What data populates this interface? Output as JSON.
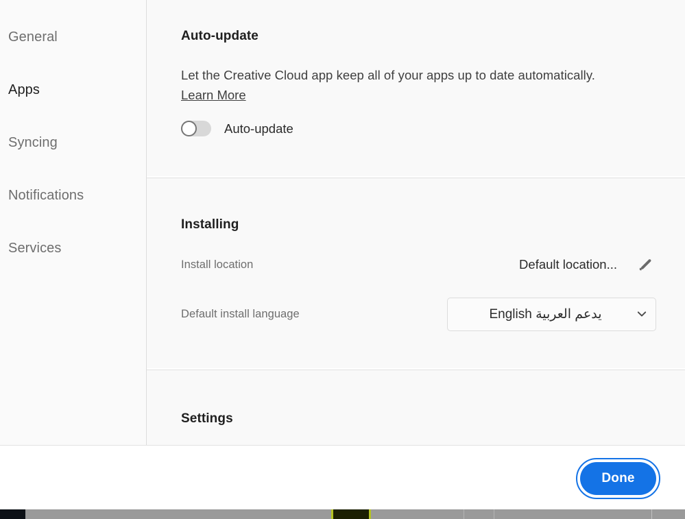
{
  "sidebar": {
    "items": [
      {
        "label": "General",
        "selected": false
      },
      {
        "label": "Apps",
        "selected": true
      },
      {
        "label": "Syncing",
        "selected": false
      },
      {
        "label": "Notifications",
        "selected": false
      },
      {
        "label": "Services",
        "selected": false
      }
    ]
  },
  "sections": {
    "auto_update": {
      "title": "Auto-update",
      "description": "Let the Creative Cloud app keep all of your apps up to date automatically.",
      "learn_more": "Learn More",
      "toggle_label": "Auto-update",
      "toggle_state": "off"
    },
    "installing": {
      "title": "Installing",
      "install_location_label": "Install location",
      "install_location_value": "Default location...",
      "edit_icon": "pencil-icon",
      "language_label": "Default install language",
      "language_value": "English يدعم العربية",
      "dropdown_icon": "chevron-down-icon"
    },
    "settings": {
      "title": "Settings"
    }
  },
  "footer": {
    "done_label": "Done"
  },
  "colors": {
    "accent": "#1473e6",
    "panel_bg": "#f9f9f9",
    "text_primary": "#1f1f1f",
    "text_muted": "#6e6e6e",
    "toggle_track_off": "#d8d8d8"
  }
}
